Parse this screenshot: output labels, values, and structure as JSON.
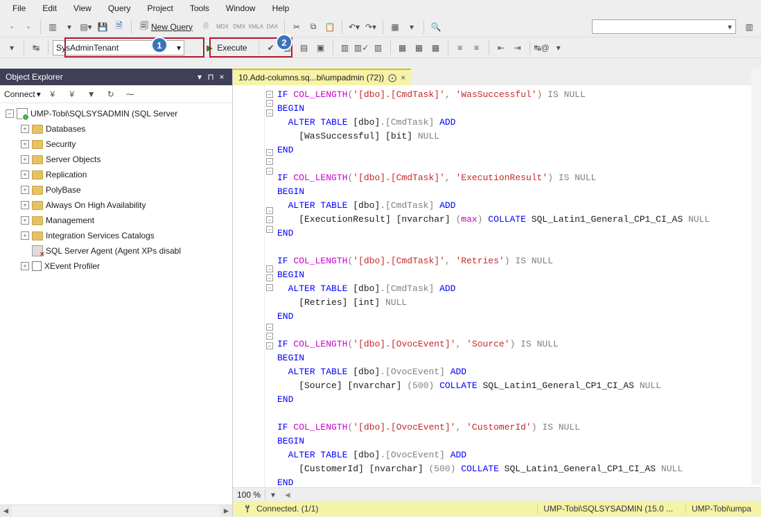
{
  "menu": [
    "File",
    "Edit",
    "View",
    "Query",
    "Project",
    "Tools",
    "Window",
    "Help"
  ],
  "toolbar": {
    "new_query": "New Query",
    "db_selected": "SysAdminTenant",
    "execute": "Execute",
    "badges": {
      "one": "1",
      "two": "2"
    }
  },
  "object_explorer": {
    "title": "Object Explorer",
    "connect": "Connect",
    "server": "UMP-Tobi\\SQLSYSADMIN (SQL Server",
    "nodes": [
      "Databases",
      "Security",
      "Server Objects",
      "Replication",
      "PolyBase",
      "Always On High Availability",
      "Management",
      "Integration Services Catalogs",
      "SQL Server Agent (Agent XPs disabl",
      "XEvent Profiler"
    ]
  },
  "tab": {
    "label": "10.Add-columns.sq...bi\\umpadmin (72))"
  },
  "code": {
    "blocks": [
      {
        "check": "IF",
        "fn": "COL_LENGTH",
        "arg1": "'[dbo].[CmdTask]'",
        "arg2": "'WasSuccessful'",
        "tail": ") IS NULL",
        "alter": "ALTER TABLE",
        "schema": "[dbo]",
        "tbl": ".[CmdTask]",
        "add": "ADD",
        "col": "[WasSuccessful] [bit]",
        "extra": "",
        "null": "NULL"
      },
      {
        "check": "IF",
        "fn": "COL_LENGTH",
        "arg1": "'[dbo].[CmdTask]'",
        "arg2": "'ExecutionResult'",
        "tail": ") IS NULL",
        "alter": "ALTER TABLE",
        "schema": "[dbo]",
        "tbl": ".[CmdTask]",
        "add": "ADD",
        "col": "[ExecutionResult] [nvarchar]",
        "extra": " (max) COLLATE SQL_Latin1_General_CP1_CI_AS",
        "null": "NULL",
        "maxkw": "max",
        "collate": "COLLATE",
        "collation": "SQL_Latin1_General_CP1_CI_AS"
      },
      {
        "check": "IF",
        "fn": "COL_LENGTH",
        "arg1": "'[dbo].[CmdTask]'",
        "arg2": "'Retries'",
        "tail": ") IS NULL",
        "alter": "ALTER TABLE",
        "schema": "[dbo]",
        "tbl": ".[CmdTask]",
        "add": "ADD",
        "col": "[Retries] [int]",
        "extra": "",
        "null": "NULL"
      },
      {
        "check": "IF",
        "fn": "COL_LENGTH",
        "arg1": "'[dbo].[OvocEvent]'",
        "arg2": "'Source'",
        "tail": ") IS NULL",
        "alter": "ALTER TABLE",
        "schema": "[dbo]",
        "tbl": ".[OvocEvent]",
        "add": "ADD",
        "col": "[Source] [nvarchar]",
        "extra": " (500) COLLATE SQL_Latin1_General_CP1_CI_AS",
        "null": "NULL",
        "num": "500",
        "collate": "COLLATE",
        "collation": "SQL_Latin1_General_CP1_CI_AS"
      },
      {
        "check": "IF",
        "fn": "COL_LENGTH",
        "arg1": "'[dbo].[OvocEvent]'",
        "arg2": "'CustomerId'",
        "tail": ") IS NULL",
        "alter": "ALTER TABLE",
        "schema": "[dbo]",
        "tbl": ".[OvocEvent]",
        "add": "ADD",
        "col": "[CustomerId] [nvarchar]",
        "extra": " (500) COLLATE SQL_Latin1_General_CP1_CI_AS",
        "null": "NULL",
        "num": "500",
        "collate": "COLLATE",
        "collation": "SQL_Latin1_General_CP1_CI_AS"
      }
    ],
    "begin": "BEGIN",
    "end": "END"
  },
  "zoom": "100 %",
  "status": {
    "connected": "Connected. (1/1)",
    "server": "UMP-Tobi\\SQLSYSADMIN (15.0 ...",
    "user": "UMP-Tobi\\umpa"
  },
  "icons": {
    "mdx": "MDX",
    "dmx": "DMX",
    "xmla": "XMLA",
    "dax": "DAX"
  }
}
